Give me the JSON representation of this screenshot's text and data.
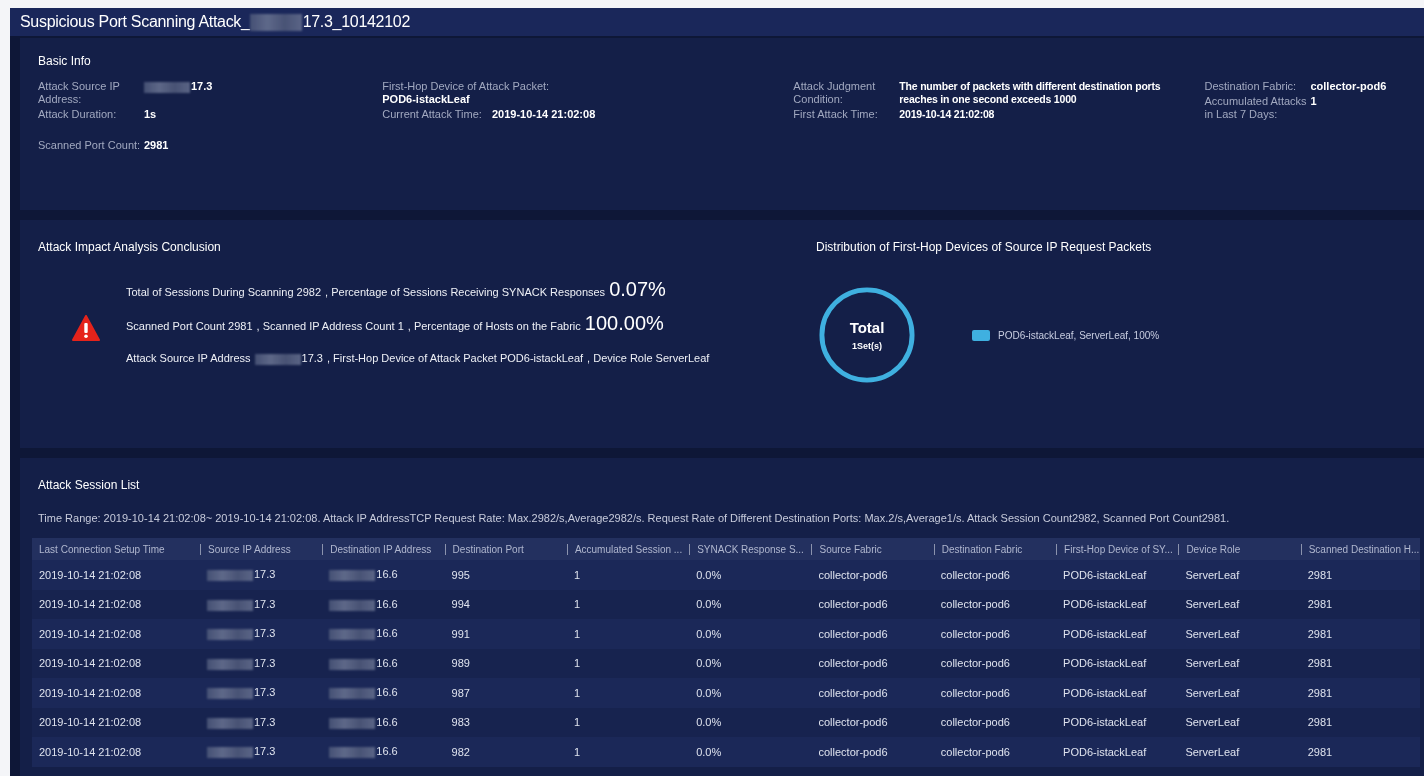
{
  "window": {
    "title_prefix": "Suspicious Port Scanning Attack_",
    "title_ip": {
      "redacted": true,
      "text": "17.3_10142102"
    }
  },
  "basic_info": {
    "title": "Basic Info",
    "columns": [
      [
        {
          "label": "Attack Source IP Address:",
          "value": "17.3",
          "redacted": true,
          "kind": "inline"
        },
        {
          "label": "Attack Duration:",
          "value": "1s",
          "kind": "inline"
        },
        {
          "label": "Scanned Port Count:",
          "value": "2981",
          "kind": "spaced"
        }
      ],
      [
        {
          "label": "First-Hop Device of Attack Packet:",
          "value": "POD6-istackLeaf",
          "kind": "stacked"
        },
        {
          "label": "Current Attack Time:",
          "value": "2019-10-14 21:02:08",
          "kind": "inline"
        }
      ],
      [
        {
          "label": "Attack Judgment Condition:",
          "value": "The number of packets with different destination ports reaches in one second exceeds 1000",
          "kind": "inline"
        },
        {
          "label": "First Attack Time:",
          "value": "2019-10-14 21:02:08",
          "kind": "inline"
        }
      ],
      [
        {
          "label": "Destination Fabric:",
          "value": "collector-pod6",
          "kind": "inline"
        },
        {
          "label": "Accumulated Attacks in Last 7 Days:",
          "value": "1",
          "kind": "inline"
        }
      ]
    ]
  },
  "impact": {
    "title": "Attack Impact Analysis Conclusion",
    "lines": [
      [
        {
          "text": "Total of Sessions During Scanning 2982",
          "kind": "text"
        },
        {
          "text": ", Percentage of Sessions Receiving SYNACK Responses",
          "kind": "text"
        },
        {
          "text": "0.07%",
          "kind": "big"
        }
      ],
      [
        {
          "text": "Scanned Port Count 2981",
          "kind": "text"
        },
        {
          "text": ", Scanned IP Address Count 1",
          "kind": "text"
        },
        {
          "text": ", Percentage of Hosts on the Fabric",
          "kind": "text"
        },
        {
          "text": "100.00%",
          "kind": "big"
        }
      ],
      [
        {
          "text": "Attack Source IP Address",
          "kind": "text"
        },
        {
          "text": "17.3",
          "kind": "redacted"
        },
        {
          "text": ", First-Hop Device of Attack Packet POD6-istackLeaf",
          "kind": "text"
        },
        {
          "text": ", Device Role ServerLeaf",
          "kind": "text"
        }
      ]
    ]
  },
  "distribution": {
    "title": "Distribution of First-Hop Devices of Source IP Request Packets",
    "center_title": "Total",
    "center_value": "1Set(s)",
    "legend": [
      {
        "label": "POD6-istackLeaf, ServerLeaf, 100%",
        "color": "#3fb0e0"
      }
    ]
  },
  "session_list": {
    "title": "Attack Session List",
    "summary": "Time Range: 2019-10-14 21:02:08~ 2019-10-14 21:02:08. Attack IP AddressTCP Request Rate: Max.2982/s,Average2982/s. Request Rate of Different Destination Ports: Max.2/s,Average1/s. Attack Session Count2982, Scanned Port Count2981.",
    "columns": [
      {
        "label": "Last Connection Setup Time"
      },
      {
        "label": "Source IP Address",
        "redacted": true
      },
      {
        "label": "Destination IP Address",
        "redacted": true
      },
      {
        "label": "Destination Port"
      },
      {
        "label": "Accumulated Session ..."
      },
      {
        "label": "SYNACK Response S..."
      },
      {
        "label": "Source Fabric"
      },
      {
        "label": "Destination Fabric"
      },
      {
        "label": "First-Hop Device of SY..."
      },
      {
        "label": "Device Role"
      },
      {
        "label": "Scanned Destination H..."
      }
    ],
    "rows": [
      [
        "2019-10-14 21:02:08",
        "17.3",
        "16.6",
        "995",
        "1",
        "0.0%",
        "collector-pod6",
        "collector-pod6",
        "POD6-istackLeaf",
        "ServerLeaf",
        "2981"
      ],
      [
        "2019-10-14 21:02:08",
        "17.3",
        "16.6",
        "994",
        "1",
        "0.0%",
        "collector-pod6",
        "collector-pod6",
        "POD6-istackLeaf",
        "ServerLeaf",
        "2981"
      ],
      [
        "2019-10-14 21:02:08",
        "17.3",
        "16.6",
        "991",
        "1",
        "0.0%",
        "collector-pod6",
        "collector-pod6",
        "POD6-istackLeaf",
        "ServerLeaf",
        "2981"
      ],
      [
        "2019-10-14 21:02:08",
        "17.3",
        "16.6",
        "989",
        "1",
        "0.0%",
        "collector-pod6",
        "collector-pod6",
        "POD6-istackLeaf",
        "ServerLeaf",
        "2981"
      ],
      [
        "2019-10-14 21:02:08",
        "17.3",
        "16.6",
        "987",
        "1",
        "0.0%",
        "collector-pod6",
        "collector-pod6",
        "POD6-istackLeaf",
        "ServerLeaf",
        "2981"
      ],
      [
        "2019-10-14 21:02:08",
        "17.3",
        "16.6",
        "983",
        "1",
        "0.0%",
        "collector-pod6",
        "collector-pod6",
        "POD6-istackLeaf",
        "ServerLeaf",
        "2981"
      ],
      [
        "2019-10-14 21:02:08",
        "17.3",
        "16.6",
        "982",
        "1",
        "0.0%",
        "collector-pod6",
        "collector-pod6",
        "POD6-istackLeaf",
        "ServerLeaf",
        "2981"
      ]
    ]
  }
}
